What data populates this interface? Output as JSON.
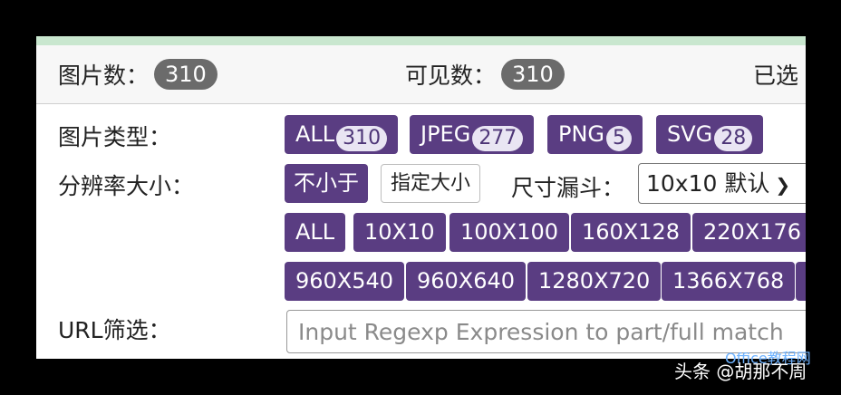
{
  "stats": {
    "image_count_label": "图片数：",
    "image_count": "310",
    "visible_count_label": "可见数：",
    "visible_count": "310",
    "selected_label": "已选"
  },
  "filters": {
    "type_label": "图片类型：",
    "types": [
      {
        "label": "ALL",
        "count": "310"
      },
      {
        "label": "JPEG",
        "count": "277"
      },
      {
        "label": "PNG",
        "count": "5"
      },
      {
        "label": "SVG",
        "count": "28"
      }
    ],
    "resolution_label": "分辨率大小：",
    "not_smaller_label": "不小于",
    "specify_size_label": "指定大小",
    "size_funnel_label": "尺寸漏斗：",
    "size_select_value": "10x10 默认",
    "resolutions_row1": [
      "ALL",
      "10X10",
      "100X100",
      "160X128",
      "220X176"
    ],
    "resolutions_row2": [
      "960X540",
      "960X640",
      "1280X720",
      "1366X768"
    ],
    "url_label": "URL筛选：",
    "url_placeholder": "Input Regexp Expression to part/full match"
  },
  "watermark": {
    "text": "头条 @胡那不周",
    "brand": "Office教程网"
  },
  "colors": {
    "chip_bg": "#5a3d82",
    "pill_bg": "#6b6b6b",
    "top_bar": "#c9e7cf"
  }
}
